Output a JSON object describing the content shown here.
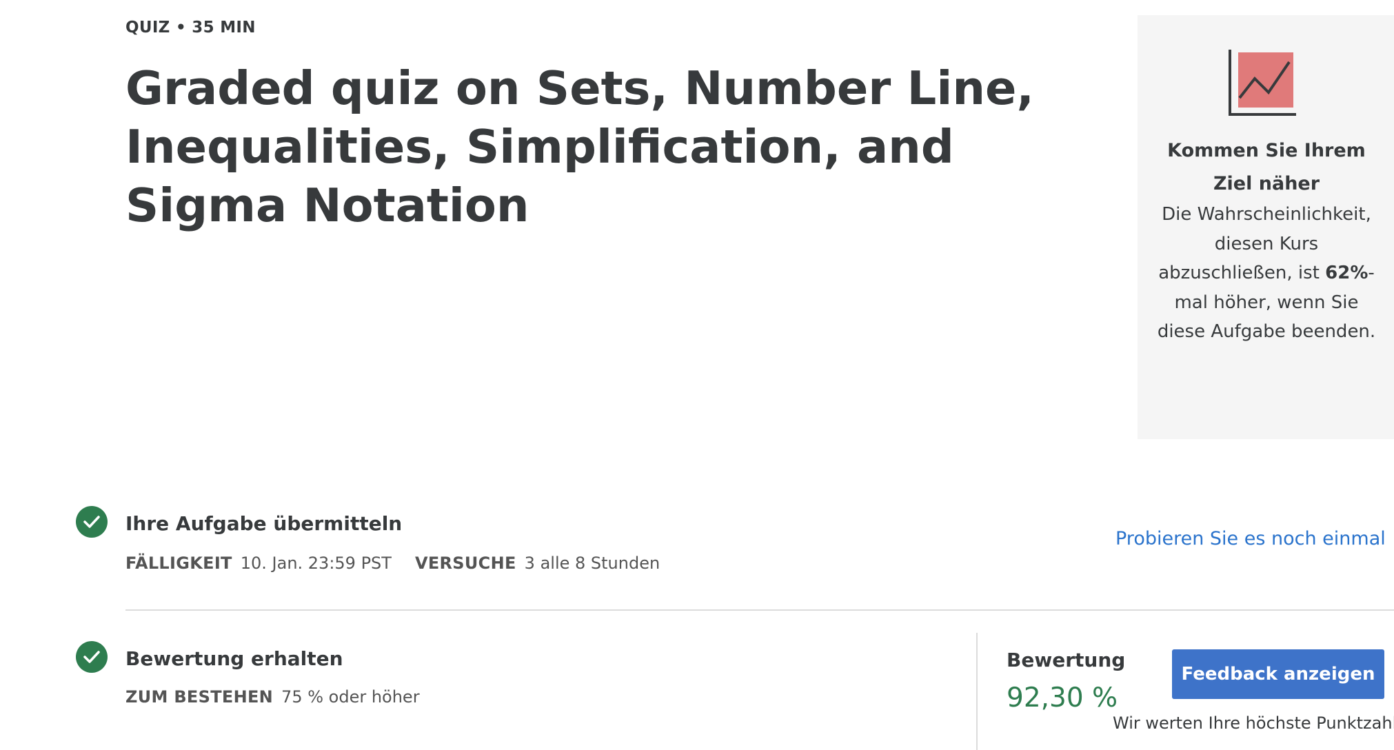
{
  "header": {
    "meta": "QUIZ • 35 MIN",
    "title": "Graded quiz on Sets, Number Line, Inequalities, Simplification, and Sigma Notation"
  },
  "goal_panel": {
    "icon": "trend-chart-icon",
    "title": "Kommen Sie Ihrem Ziel näher",
    "text_before": "Die Wahrscheinlichkeit, diesen Kurs abzuschließen, ist ",
    "highlight": "62%",
    "text_after": "-mal höher, wenn Sie diese Aufgabe beenden."
  },
  "submit_step": {
    "icon": "check-circle-icon",
    "title": "Ihre Aufgabe übermitteln",
    "due_label": "FÄLLIGKEIT",
    "due_value": "10. Jan. 23:59 PST",
    "attempts_label": "VERSUCHE",
    "attempts_value": "3 alle 8 Stunden",
    "retry_link": "Probieren Sie es noch einmal"
  },
  "grade_step": {
    "icon": "check-circle-icon",
    "title": "Bewertung erhalten",
    "pass_label": "ZUM BESTEHEN",
    "pass_value": "75 % oder höher",
    "grade_label": "Bewertung",
    "grade_value": "92,30 %",
    "feedback_button": "Feedback anzeigen",
    "best_note": "Wir werten Ihre höchste Punktzahl."
  },
  "colors": {
    "success": "#2e7d4f",
    "link": "#2a73cc",
    "button": "#3e73c9",
    "panel_bg": "#f5f5f5",
    "icon_fill": "#e07a7a"
  }
}
